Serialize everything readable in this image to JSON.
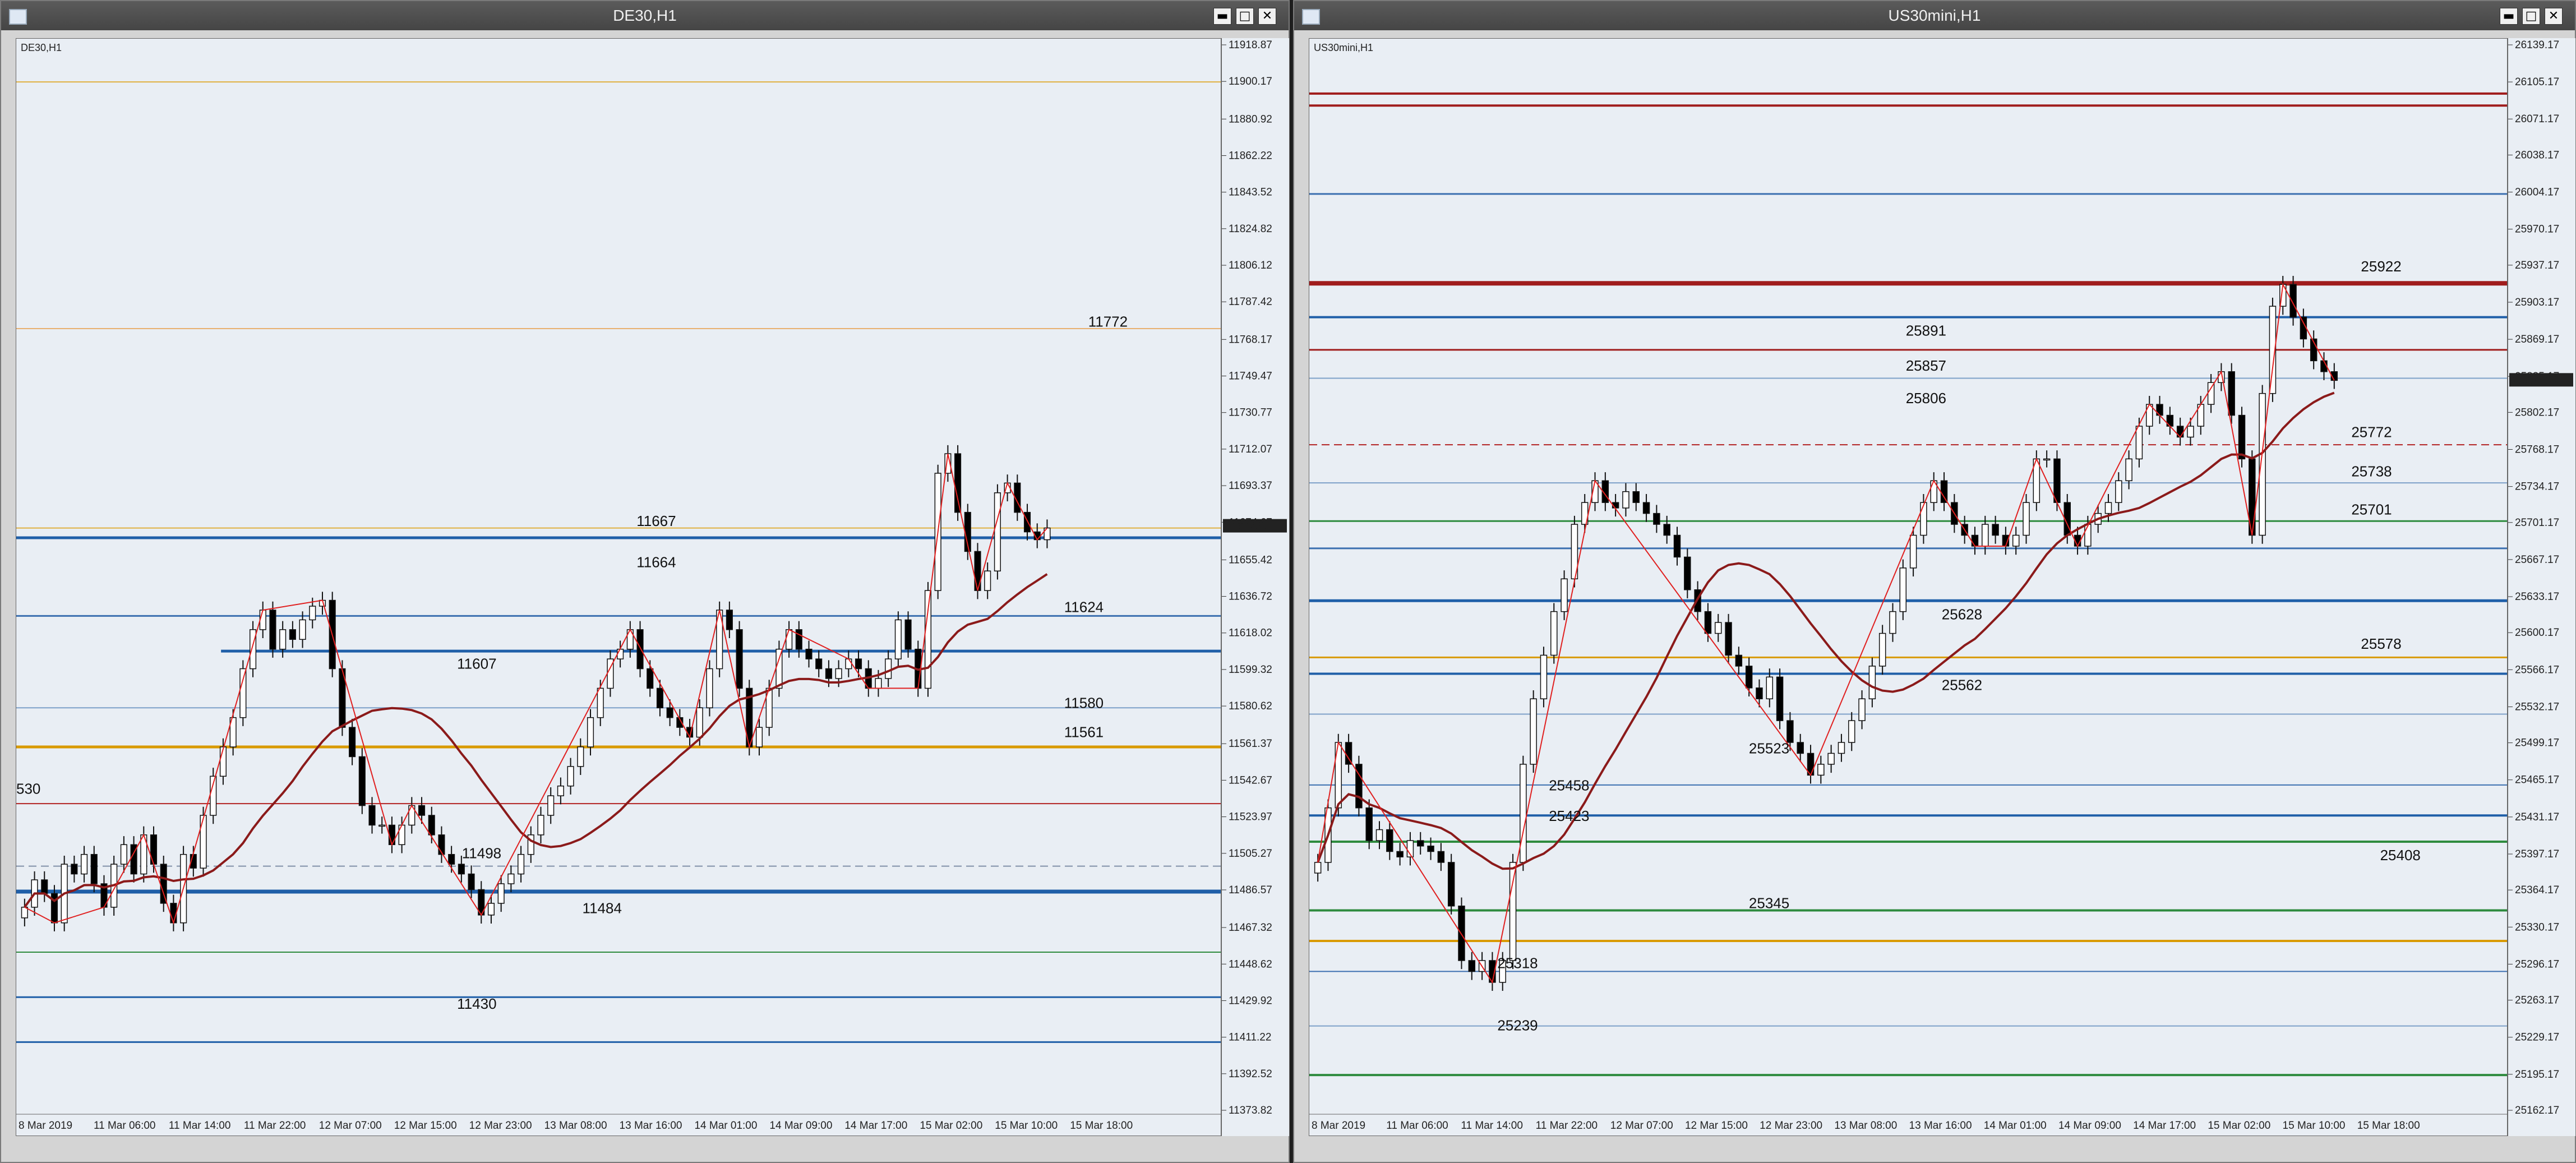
{
  "charts": [
    {
      "window_title": "DE30,H1",
      "chart_tag": "DE30,H1",
      "price_min": 11373.82,
      "price_max": 11918.87,
      "y_ticks": [
        "11918.87",
        "11900.17",
        "11880.92",
        "11862.22",
        "11843.52",
        "11824.82",
        "11806.12",
        "11787.42",
        "11768.17",
        "11749.47",
        "11730.77",
        "11712.07",
        "11693.37",
        "11674.67",
        "11655.42",
        "11636.72",
        "11618.02",
        "11599.32",
        "11580.62",
        "11561.37",
        "11542.67",
        "11523.97",
        "11505.27",
        "11486.57",
        "11467.32",
        "11448.62",
        "11429.92",
        "11411.22",
        "11392.52",
        "11373.82"
      ],
      "current_price": "11672.85",
      "x_labels": [
        "8 Mar 2019",
        "11 Mar 06:00",
        "11 Mar 14:00",
        "11 Mar 22:00",
        "12 Mar 07:00",
        "12 Mar 15:00",
        "12 Mar 23:00",
        "13 Mar 08:00",
        "13 Mar 16:00",
        "14 Mar 01:00",
        "14 Mar 09:00",
        "14 Mar 17:00",
        "15 Mar 02:00",
        "15 Mar 10:00",
        "15 Mar 18:00"
      ],
      "levels": [
        {
          "price": 11900.2,
          "color": "#e0b040",
          "width": 2
        },
        {
          "price": 11774.0,
          "color": "#e8b070",
          "width": 2
        },
        {
          "price": 11672.0,
          "color": "#e0b040",
          "width": 2
        },
        {
          "price": 11667.0,
          "color": "#1f5fa8",
          "width": 5
        },
        {
          "price": 11627.0,
          "color": "#3b6fb0",
          "width": 3
        },
        {
          "price": 11609.0,
          "color": "#1f5fa8",
          "width": 5,
          "start": 0.17
        },
        {
          "price": 11580.0,
          "color": "#7da0c8",
          "width": 2
        },
        {
          "price": 11560.0,
          "color": "#d99a00",
          "width": 5
        },
        {
          "price": 11531.0,
          "color": "#b22222",
          "width": 2
        },
        {
          "price": 11499.0,
          "color": "#8090a8",
          "width": 2,
          "dash": true
        },
        {
          "price": 11486.0,
          "color": "#1f5fa8",
          "width": 7
        },
        {
          "price": 11455.0,
          "color": "#2e8b3e",
          "width": 2
        },
        {
          "price": 11432.0,
          "color": "#1f5fa8",
          "width": 3
        },
        {
          "price": 11409.0,
          "color": "#1f5fa8",
          "width": 3
        }
      ],
      "labels": [
        {
          "text": "11772",
          "x": 0.89,
          "price": 11775
        },
        {
          "text": "11667",
          "x": 0.515,
          "price": 11673
        },
        {
          "text": "11664",
          "x": 0.515,
          "price": 11652
        },
        {
          "text": "11624",
          "x": 0.87,
          "price": 11629
        },
        {
          "text": "11607",
          "x": 0.366,
          "price": 11600
        },
        {
          "text": "11580",
          "x": 0.87,
          "price": 11580
        },
        {
          "text": "11561",
          "x": 0.87,
          "price": 11565
        },
        {
          "text": "530",
          "x": 0.0,
          "price": 11536
        },
        {
          "text": "11498",
          "x": 0.37,
          "price": 11503
        },
        {
          "text": "11484",
          "x": 0.47,
          "price": 11475
        },
        {
          "text": "11430",
          "x": 0.366,
          "price": 11426
        }
      ],
      "closes": [
        11478,
        11492,
        11485,
        11470,
        11500,
        11495,
        11505,
        11490,
        11478,
        11500,
        11510,
        11495,
        11515,
        11500,
        11480,
        11470,
        11505,
        11498,
        11525,
        11545,
        11560,
        11575,
        11600,
        11620,
        11630,
        11610,
        11620,
        11615,
        11625,
        11632,
        11635,
        11600,
        11570,
        11555,
        11530,
        11520,
        11520,
        11510,
        11520,
        11530,
        11525,
        11515,
        11505,
        11500,
        11495,
        11487,
        11474,
        11480,
        11490,
        11495,
        11505,
        11515,
        11525,
        11535,
        11540,
        11550,
        11560,
        11575,
        11590,
        11605,
        11610,
        11620,
        11600,
        11590,
        11580,
        11575,
        11570,
        11565,
        11580,
        11600,
        11630,
        11620,
        11590,
        11560,
        11570,
        11590,
        11610,
        11620,
        11610,
        11605,
        11600,
        11595,
        11600,
        11605,
        11600,
        11590,
        11595,
        11605,
        11625,
        11610,
        11590,
        11640,
        11700,
        11710,
        11680,
        11660,
        11640,
        11650,
        11690,
        11695,
        11680,
        11670,
        11666,
        11672
      ]
    },
    {
      "window_title": "US30mini,H1",
      "chart_tag": "US30mini,H1",
      "price_min": 25162.17,
      "price_max": 26139.17,
      "y_ticks": [
        "26139.17",
        "26105.17",
        "26071.17",
        "26038.17",
        "26004.17",
        "25970.17",
        "25937.17",
        "25903.17",
        "25869.17",
        "25835.17",
        "25802.17",
        "25768.17",
        "25734.17",
        "25701.17",
        "25667.17",
        "25633.17",
        "25600.17",
        "25566.17",
        "25532.17",
        "25499.17",
        "25465.17",
        "25431.17",
        "25397.17",
        "25364.17",
        "25330.17",
        "25296.17",
        "25263.17",
        "25229.17",
        "25195.17",
        "25162.17"
      ],
      "current_price": "25832.00",
      "x_labels": [
        "8 Mar 2019",
        "11 Mar 06:00",
        "11 Mar 14:00",
        "11 Mar 22:00",
        "12 Mar 07:00",
        "12 Mar 15:00",
        "12 Mar 23:00",
        "13 Mar 08:00",
        "13 Mar 16:00",
        "14 Mar 01:00",
        "14 Mar 09:00",
        "14 Mar 17:00",
        "15 Mar 02:00",
        "15 Mar 10:00",
        "15 Mar 18:00"
      ],
      "levels": [
        {
          "price": 26095.0,
          "color": "#a01c1c",
          "width": 4
        },
        {
          "price": 26084.0,
          "color": "#a01c1c",
          "width": 4
        },
        {
          "price": 26003.0,
          "color": "#3b6fb0",
          "width": 3
        },
        {
          "price": 25921.0,
          "color": "#a01c1c",
          "width": 8
        },
        {
          "price": 25890.0,
          "color": "#1f5fa8",
          "width": 4
        },
        {
          "price": 25860.0,
          "color": "#a01c1c",
          "width": 3
        },
        {
          "price": 25834.0,
          "color": "#7da0c8",
          "width": 2
        },
        {
          "price": 25773.0,
          "color": "#b22222",
          "width": 2,
          "dash": true
        },
        {
          "price": 25738.0,
          "color": "#7da0c8",
          "width": 2
        },
        {
          "price": 25703.0,
          "color": "#2e8b3e",
          "width": 3
        },
        {
          "price": 25678.0,
          "color": "#3b6fb0",
          "width": 3
        },
        {
          "price": 25630.0,
          "color": "#1f5fa8",
          "width": 5
        },
        {
          "price": 25578.0,
          "color": "#d99a00",
          "width": 3
        },
        {
          "price": 25563.0,
          "color": "#1f5fa8",
          "width": 4
        },
        {
          "price": 25526.0,
          "color": "#7da0c8",
          "width": 2
        },
        {
          "price": 25461.0,
          "color": "#3b6fb0",
          "width": 2
        },
        {
          "price": 25433.0,
          "color": "#1f5fa8",
          "width": 4
        },
        {
          "price": 25409.0,
          "color": "#2e8b3e",
          "width": 4
        },
        {
          "price": 25346.0,
          "color": "#2e8b3e",
          "width": 4
        },
        {
          "price": 25318.0,
          "color": "#d99a00",
          "width": 4
        },
        {
          "price": 25290.0,
          "color": "#3b6fb0",
          "width": 2
        },
        {
          "price": 25240.0,
          "color": "#7da0c8",
          "width": 2
        },
        {
          "price": 25195.0,
          "color": "#2e8b3e",
          "width": 4
        }
      ],
      "labels": [
        {
          "text": "25922",
          "x": 0.878,
          "price": 25932
        },
        {
          "text": "25891",
          "x": 0.498,
          "price": 25873
        },
        {
          "text": "25857",
          "x": 0.498,
          "price": 25841
        },
        {
          "text": "25806",
          "x": 0.498,
          "price": 25811
        },
        {
          "text": "25772",
          "x": 0.87,
          "price": 25780
        },
        {
          "text": "25738",
          "x": 0.87,
          "price": 25744
        },
        {
          "text": "25701",
          "x": 0.87,
          "price": 25709
        },
        {
          "text": "25628",
          "x": 0.528,
          "price": 25613
        },
        {
          "text": "25578",
          "x": 0.878,
          "price": 25586
        },
        {
          "text": "25562",
          "x": 0.528,
          "price": 25548
        },
        {
          "text": "25523",
          "x": 0.367,
          "price": 25490
        },
        {
          "text": "25458",
          "x": 0.2,
          "price": 25456
        },
        {
          "text": "25423",
          "x": 0.2,
          "price": 25428
        },
        {
          "text": "25408",
          "x": 0.894,
          "price": 25392
        },
        {
          "text": "25345",
          "x": 0.367,
          "price": 25348
        },
        {
          "text": "25318",
          "x": 0.157,
          "price": 25293
        },
        {
          "text": "25239",
          "x": 0.157,
          "price": 25236
        }
      ],
      "closes": [
        25390,
        25440,
        25500,
        25480,
        25440,
        25410,
        25420,
        25400,
        25395,
        25410,
        25405,
        25400,
        25390,
        25350,
        25300,
        25290,
        25300,
        25280,
        25300,
        25390,
        25480,
        25540,
        25580,
        25620,
        25650,
        25700,
        25720,
        25740,
        25720,
        25715,
        25730,
        25720,
        25710,
        25700,
        25690,
        25670,
        25640,
        25620,
        25600,
        25610,
        25580,
        25570,
        25550,
        25540,
        25560,
        25520,
        25500,
        25490,
        25470,
        25480,
        25490,
        25500,
        25520,
        25540,
        25570,
        25600,
        25620,
        25660,
        25690,
        25720,
        25740,
        25720,
        25700,
        25690,
        25680,
        25700,
        25690,
        25680,
        25690,
        25720,
        25760,
        25760,
        25720,
        25690,
        25680,
        25700,
        25710,
        25720,
        25740,
        25760,
        25790,
        25810,
        25800,
        25790,
        25780,
        25790,
        25810,
        25830,
        25840,
        25800,
        25760,
        25690,
        25820,
        25900,
        25920,
        25890,
        25870,
        25850,
        25840,
        25832
      ]
    }
  ]
}
